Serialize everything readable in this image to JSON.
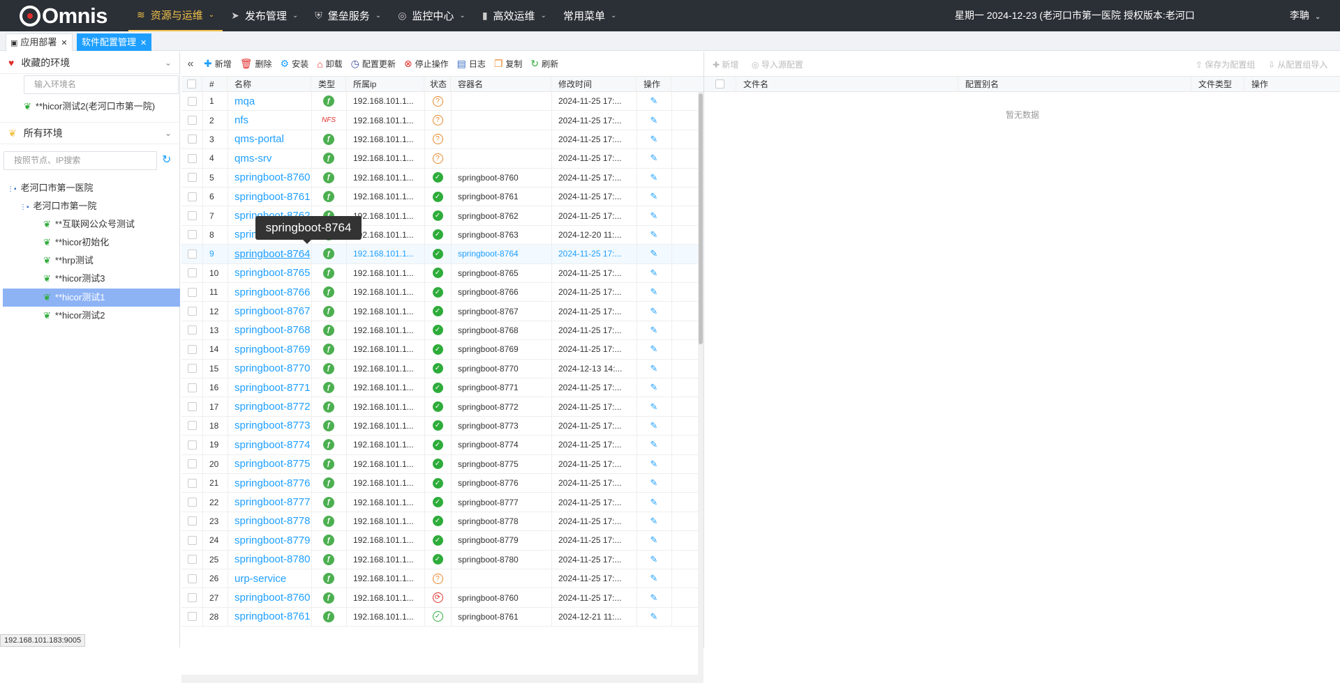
{
  "header": {
    "logo": "Omnis",
    "menu": [
      {
        "label": "资源与运维",
        "icon": "layers-icon",
        "active": true
      },
      {
        "label": "发布管理",
        "icon": "send-icon",
        "active": false
      },
      {
        "label": "堡垒服务",
        "icon": "shield-icon",
        "active": false
      },
      {
        "label": "监控中心",
        "icon": "monitor-icon",
        "active": false
      },
      {
        "label": "高效运维",
        "icon": "bar-chart-icon",
        "active": false
      },
      {
        "label": "常用菜单",
        "icon": "",
        "active": false
      }
    ],
    "date_info": "星期一 2024-12-23   (老河口市第一医院 授权版本:老河口",
    "user": "李聃"
  },
  "tabs": [
    {
      "label": "应用部署",
      "active": false
    },
    {
      "label": "软件配置管理",
      "active": true
    }
  ],
  "left": {
    "fav_title": "收藏的环境",
    "fav_search_placeholder": "输入环境名",
    "fav_items": [
      "**hicor测试2(老河口市第一院)"
    ],
    "all_title": "所有环境",
    "all_search_placeholder": "按照节点、IP搜索",
    "tree": [
      {
        "label": "老河口市第一医院",
        "level": 0
      },
      {
        "label": "老河口市第一院",
        "level": 1
      },
      {
        "label": "**互联网公众号测试",
        "level": 2
      },
      {
        "label": "**hicor初始化",
        "level": 2
      },
      {
        "label": "**hrp测试",
        "level": 2
      },
      {
        "label": "**hicor测试3",
        "level": 2
      },
      {
        "label": "**hicor测试1",
        "level": 2,
        "selected": true
      },
      {
        "label": "**hicor测试2",
        "level": 2
      }
    ],
    "status_url": "192.168.101.183:9005"
  },
  "toolbar": {
    "add": "新增",
    "delete": "删除",
    "install": "安装",
    "uninstall": "卸载",
    "config_update": "配置更新",
    "stop": "停止操作",
    "log": "日志",
    "copy": "复制",
    "refresh": "刷新"
  },
  "table": {
    "headers": [
      "#",
      "名称",
      "类型",
      "所属ip",
      "状态",
      "容器名",
      "修改时间",
      "操作"
    ],
    "tooltip": "springboot-8764",
    "rows": [
      {
        "n": "1",
        "name": "mqa",
        "type": "spring",
        "ip": "192.168.101.1...",
        "status": "unknown",
        "container": "",
        "time": "2024-11-25 17:..."
      },
      {
        "n": "2",
        "name": "nfs",
        "type": "nfs",
        "ip": "192.168.101.1...",
        "status": "unknown",
        "container": "",
        "time": "2024-11-25 17:..."
      },
      {
        "n": "3",
        "name": "qms-portal",
        "type": "spring",
        "ip": "192.168.101.1...",
        "status": "unknown",
        "container": "",
        "time": "2024-11-25 17:..."
      },
      {
        "n": "4",
        "name": "qms-srv",
        "type": "spring",
        "ip": "192.168.101.1...",
        "status": "unknown",
        "container": "",
        "time": "2024-11-25 17:..."
      },
      {
        "n": "5",
        "name": "springboot-8760",
        "type": "spring",
        "ip": "192.168.101.1...",
        "status": "ok",
        "container": "springboot-8760",
        "time": "2024-11-25 17:..."
      },
      {
        "n": "6",
        "name": "springboot-8761",
        "type": "spring",
        "ip": "192.168.101.1...",
        "status": "ok",
        "container": "springboot-8761",
        "time": "2024-11-25 17:..."
      },
      {
        "n": "7",
        "name": "springboot-8762",
        "type": "spring",
        "ip": "192.168.101.1...",
        "status": "ok",
        "container": "springboot-8762",
        "time": "2024-11-25 17:..."
      },
      {
        "n": "8",
        "name": "springboot-8763",
        "type": "spring",
        "ip": "192.168.101.1...",
        "status": "ok",
        "container": "springboot-8763",
        "time": "2024-12-20 11:..."
      },
      {
        "n": "9",
        "name": "springboot-8764",
        "type": "spring",
        "ip": "192.168.101.1...",
        "status": "ok",
        "container": "springboot-8764",
        "time": "2024-11-25 17:...",
        "selected": true
      },
      {
        "n": "10",
        "name": "springboot-8765",
        "type": "spring",
        "ip": "192.168.101.1...",
        "status": "ok",
        "container": "springboot-8765",
        "time": "2024-11-25 17:..."
      },
      {
        "n": "11",
        "name": "springboot-8766",
        "type": "spring",
        "ip": "192.168.101.1...",
        "status": "ok",
        "container": "springboot-8766",
        "time": "2024-11-25 17:..."
      },
      {
        "n": "12",
        "name": "springboot-8767",
        "type": "spring",
        "ip": "192.168.101.1...",
        "status": "ok",
        "container": "springboot-8767",
        "time": "2024-11-25 17:..."
      },
      {
        "n": "13",
        "name": "springboot-8768",
        "type": "spring",
        "ip": "192.168.101.1...",
        "status": "ok",
        "container": "springboot-8768",
        "time": "2024-11-25 17:..."
      },
      {
        "n": "14",
        "name": "springboot-8769",
        "type": "spring",
        "ip": "192.168.101.1...",
        "status": "ok",
        "container": "springboot-8769",
        "time": "2024-11-25 17:..."
      },
      {
        "n": "15",
        "name": "springboot-8770",
        "type": "spring",
        "ip": "192.168.101.1...",
        "status": "ok",
        "container": "springboot-8770",
        "time": "2024-12-13 14:..."
      },
      {
        "n": "16",
        "name": "springboot-8771",
        "type": "spring",
        "ip": "192.168.101.1...",
        "status": "ok",
        "container": "springboot-8771",
        "time": "2024-11-25 17:..."
      },
      {
        "n": "17",
        "name": "springboot-8772",
        "type": "spring",
        "ip": "192.168.101.1...",
        "status": "ok",
        "container": "springboot-8772",
        "time": "2024-11-25 17:..."
      },
      {
        "n": "18",
        "name": "springboot-8773",
        "type": "spring",
        "ip": "192.168.101.1...",
        "status": "ok",
        "container": "springboot-8773",
        "time": "2024-11-25 17:..."
      },
      {
        "n": "19",
        "name": "springboot-8774",
        "type": "spring",
        "ip": "192.168.101.1...",
        "status": "ok",
        "container": "springboot-8774",
        "time": "2024-11-25 17:..."
      },
      {
        "n": "20",
        "name": "springboot-8775",
        "type": "spring",
        "ip": "192.168.101.1...",
        "status": "ok",
        "container": "springboot-8775",
        "time": "2024-11-25 17:..."
      },
      {
        "n": "21",
        "name": "springboot-8776",
        "type": "spring",
        "ip": "192.168.101.1...",
        "status": "ok",
        "container": "springboot-8776",
        "time": "2024-11-25 17:..."
      },
      {
        "n": "22",
        "name": "springboot-8777",
        "type": "spring",
        "ip": "192.168.101.1...",
        "status": "ok",
        "container": "springboot-8777",
        "time": "2024-11-25 17:..."
      },
      {
        "n": "23",
        "name": "springboot-8778",
        "type": "spring",
        "ip": "192.168.101.1...",
        "status": "ok",
        "container": "springboot-8778",
        "time": "2024-11-25 17:..."
      },
      {
        "n": "24",
        "name": "springboot-8779",
        "type": "spring",
        "ip": "192.168.101.1...",
        "status": "ok",
        "container": "springboot-8779",
        "time": "2024-11-25 17:..."
      },
      {
        "n": "25",
        "name": "springboot-8780",
        "type": "spring",
        "ip": "192.168.101.1...",
        "status": "ok",
        "container": "springboot-8780",
        "time": "2024-11-25 17:..."
      },
      {
        "n": "26",
        "name": "urp-service",
        "type": "spring",
        "ip": "192.168.101.1...",
        "status": "unknown",
        "container": "",
        "time": "2024-11-25 17:..."
      },
      {
        "n": "27",
        "name": "springboot-8760",
        "type": "spring",
        "ip": "192.168.101.1...",
        "status": "error",
        "container": "springboot-8760",
        "time": "2024-11-25 17:..."
      },
      {
        "n": "28",
        "name": "springboot-8761",
        "type": "spring",
        "ip": "192.168.101.1...",
        "status": "ok2",
        "container": "springboot-8761",
        "time": "2024-12-21 11:..."
      }
    ]
  },
  "right": {
    "add": "新增",
    "import_source": "导入源配置",
    "save_group": "保存为配置组",
    "import_group": "从配置组导入",
    "headers": [
      "文件名",
      "配置别名",
      "文件类型",
      "操作"
    ],
    "empty": "暂无数据"
  },
  "colors": {
    "accent": "#1e9fff",
    "topbar": "#2b2f36",
    "active_menu": "#f3c34a",
    "ok": "#2eac3a",
    "warn": "#e8862a",
    "error": "#e0302d"
  }
}
